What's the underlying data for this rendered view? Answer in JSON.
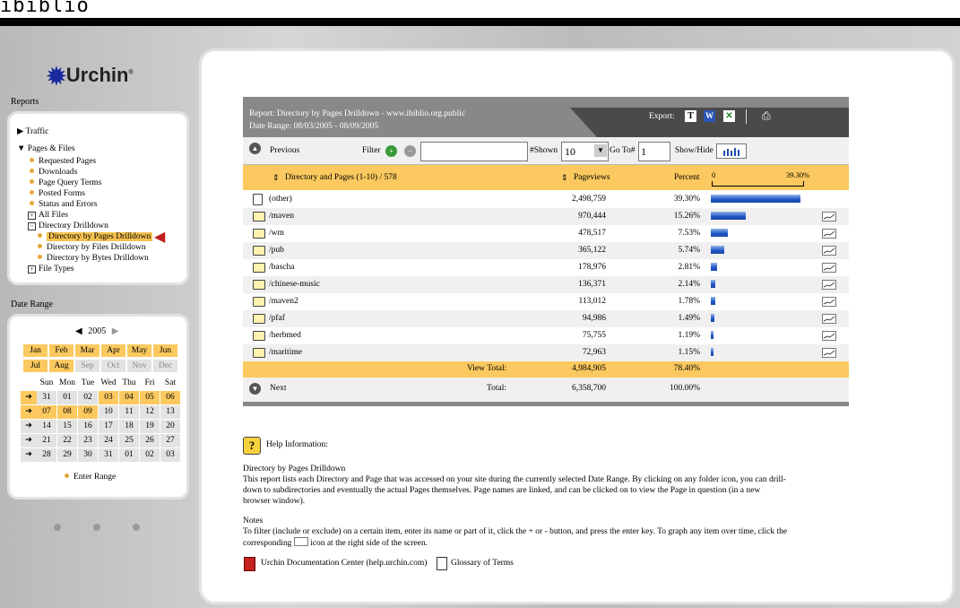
{
  "site_logo": "ibiblio",
  "brand": "Urchin",
  "sidebar": {
    "reports_label": "Reports",
    "traffic": "Traffic",
    "pages_files": "Pages & Files",
    "items": [
      "Requested Pages",
      "Downloads",
      "Page Query Terms",
      "Posted Forms",
      "Status and Errors"
    ],
    "all_files": "All Files",
    "dir_drilldown": "Directory Drilldown",
    "sub_items": [
      "Directory by Pages Drilldown",
      "Directory by Files Drilldown",
      "Directory by Bytes Drilldown"
    ],
    "file_types": "File Types",
    "date_range_label": "Date Range"
  },
  "calendar": {
    "year": "2005",
    "months": [
      "Jan",
      "Feb",
      "Mar",
      "Apr",
      "May",
      "Jun",
      "Jul",
      "Aug",
      "Sep",
      "Oct",
      "Nov",
      "Dec"
    ],
    "weekdays": [
      "Sun",
      "Mon",
      "Tue",
      "Wed",
      "Thu",
      "Fri",
      "Sat"
    ],
    "weeks": [
      [
        "31",
        "01",
        "02",
        "03",
        "04",
        "05",
        "06"
      ],
      [
        "07",
        "08",
        "09",
        "10",
        "11",
        "12",
        "13"
      ],
      [
        "14",
        "15",
        "16",
        "17",
        "18",
        "19",
        "20"
      ],
      [
        "21",
        "22",
        "23",
        "24",
        "25",
        "26",
        "27"
      ],
      [
        "28",
        "29",
        "30",
        "31",
        "01",
        "02",
        "03"
      ]
    ],
    "enter_range": "Enter Range"
  },
  "report": {
    "title": "Report: Directory by Pages Drilldown - www.ibiblio.org.public",
    "date_range": "Date Range: 08/03/2005 - 08/09/2005",
    "export_label": "Export:",
    "previous": "Previous",
    "filter": "Filter",
    "shown_label": "#Shown",
    "shown_value": "10",
    "goto_label": "Go To#",
    "goto_value": "1",
    "showhide": "Show/Hide",
    "col_dir": "Directory and Pages",
    "col_range": "(1-10) / 578",
    "col_pageviews": "Pageviews",
    "col_percent": "Percent",
    "scale_min": "0",
    "scale_max": "39.30%",
    "rows": [
      {
        "name": "(other)",
        "pageviews": "2,498,759",
        "percent": "39.30%",
        "frac": 0.393
      },
      {
        "name": "/maven",
        "pageviews": "970,444",
        "percent": "15.26%",
        "frac": 0.1526
      },
      {
        "name": "/wm",
        "pageviews": "478,517",
        "percent": "7.53%",
        "frac": 0.0753
      },
      {
        "name": "/pub",
        "pageviews": "365,122",
        "percent": "5.74%",
        "frac": 0.0574
      },
      {
        "name": "/bascha",
        "pageviews": "178,976",
        "percent": "2.81%",
        "frac": 0.0281
      },
      {
        "name": "/chinese-music",
        "pageviews": "136,371",
        "percent": "2.14%",
        "frac": 0.0214
      },
      {
        "name": "/maven2",
        "pageviews": "113,012",
        "percent": "1.78%",
        "frac": 0.0178
      },
      {
        "name": "/pfaf",
        "pageviews": "94,986",
        "percent": "1.49%",
        "frac": 0.0149
      },
      {
        "name": "/herbmed",
        "pageviews": "75,755",
        "percent": "1.19%",
        "frac": 0.0119
      },
      {
        "name": "/maritime",
        "pageviews": "72,963",
        "percent": "1.15%",
        "frac": 0.0115
      }
    ],
    "view_total_label": "View Total:",
    "view_total_pv": "4,984,905",
    "view_total_pct": "78.40%",
    "next": "Next",
    "total_label": "Total:",
    "total_pv": "6,358,700",
    "total_pct": "100.00%"
  },
  "help": {
    "header": "Help Information:",
    "title": "Directory by Pages Drilldown",
    "body": "This report lists each Directory and Page that was accessed on your site during the currently selected Date Range. By clicking on any folder icon, you can drill-down to subdirectories and eventually the actual Pages themselves. Page names are linked, and can be clicked on to view the Page in question (in a new browser window).",
    "notes_title": "Notes",
    "notes_a": "To filter (include or exclude) on a certain item, enter its name or part of it, click the + or - button, and press the enter key. To graph any item over time, click the corresponding",
    "notes_b": "icon at the right side of the screen.",
    "doc_link": "Urchin Documentation Center (help.urchin.com)",
    "glossary": "Glossary of Terms"
  }
}
